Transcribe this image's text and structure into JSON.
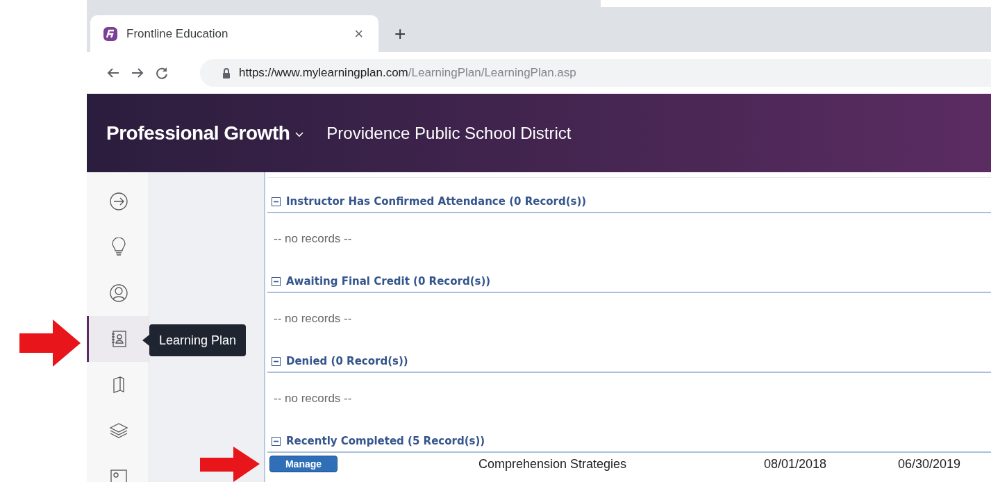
{
  "browser": {
    "tab_title": "Frontline Education",
    "tab_close": "×",
    "new_tab": "+",
    "url_host": "https://www.mylearningplan.com",
    "url_path": "/LearningPlan/LearningPlan.asp"
  },
  "header": {
    "app_title": "Professional Growth",
    "district": "Providence Public School District"
  },
  "sidebar": {
    "items": [
      {
        "kind": "arrow",
        "selected": false
      },
      {
        "kind": "bulb",
        "selected": false
      },
      {
        "kind": "user",
        "selected": false
      },
      {
        "kind": "plan",
        "selected": true
      },
      {
        "kind": "book",
        "selected": false
      },
      {
        "kind": "layers",
        "selected": false
      },
      {
        "kind": "badge",
        "selected": false
      }
    ],
    "tooltip": "Learning Plan"
  },
  "sections": [
    {
      "title": "Instructor Has Confirmed Attendance (0 Record(s))",
      "expanded": true,
      "empty_text": "-- no records --"
    },
    {
      "title": "Awaiting Final Credit (0 Record(s))",
      "expanded": true,
      "empty_text": "-- no records --"
    },
    {
      "title": "Denied (0 Record(s))",
      "expanded": true,
      "empty_text": "-- no records --"
    },
    {
      "title": "Recently Completed (5 Record(s))",
      "expanded": true,
      "rows": [
        {
          "button": "Manage",
          "title": "Comprehension Strategies",
          "start": "08/01/2018",
          "end": "06/30/2019"
        }
      ]
    }
  ]
}
